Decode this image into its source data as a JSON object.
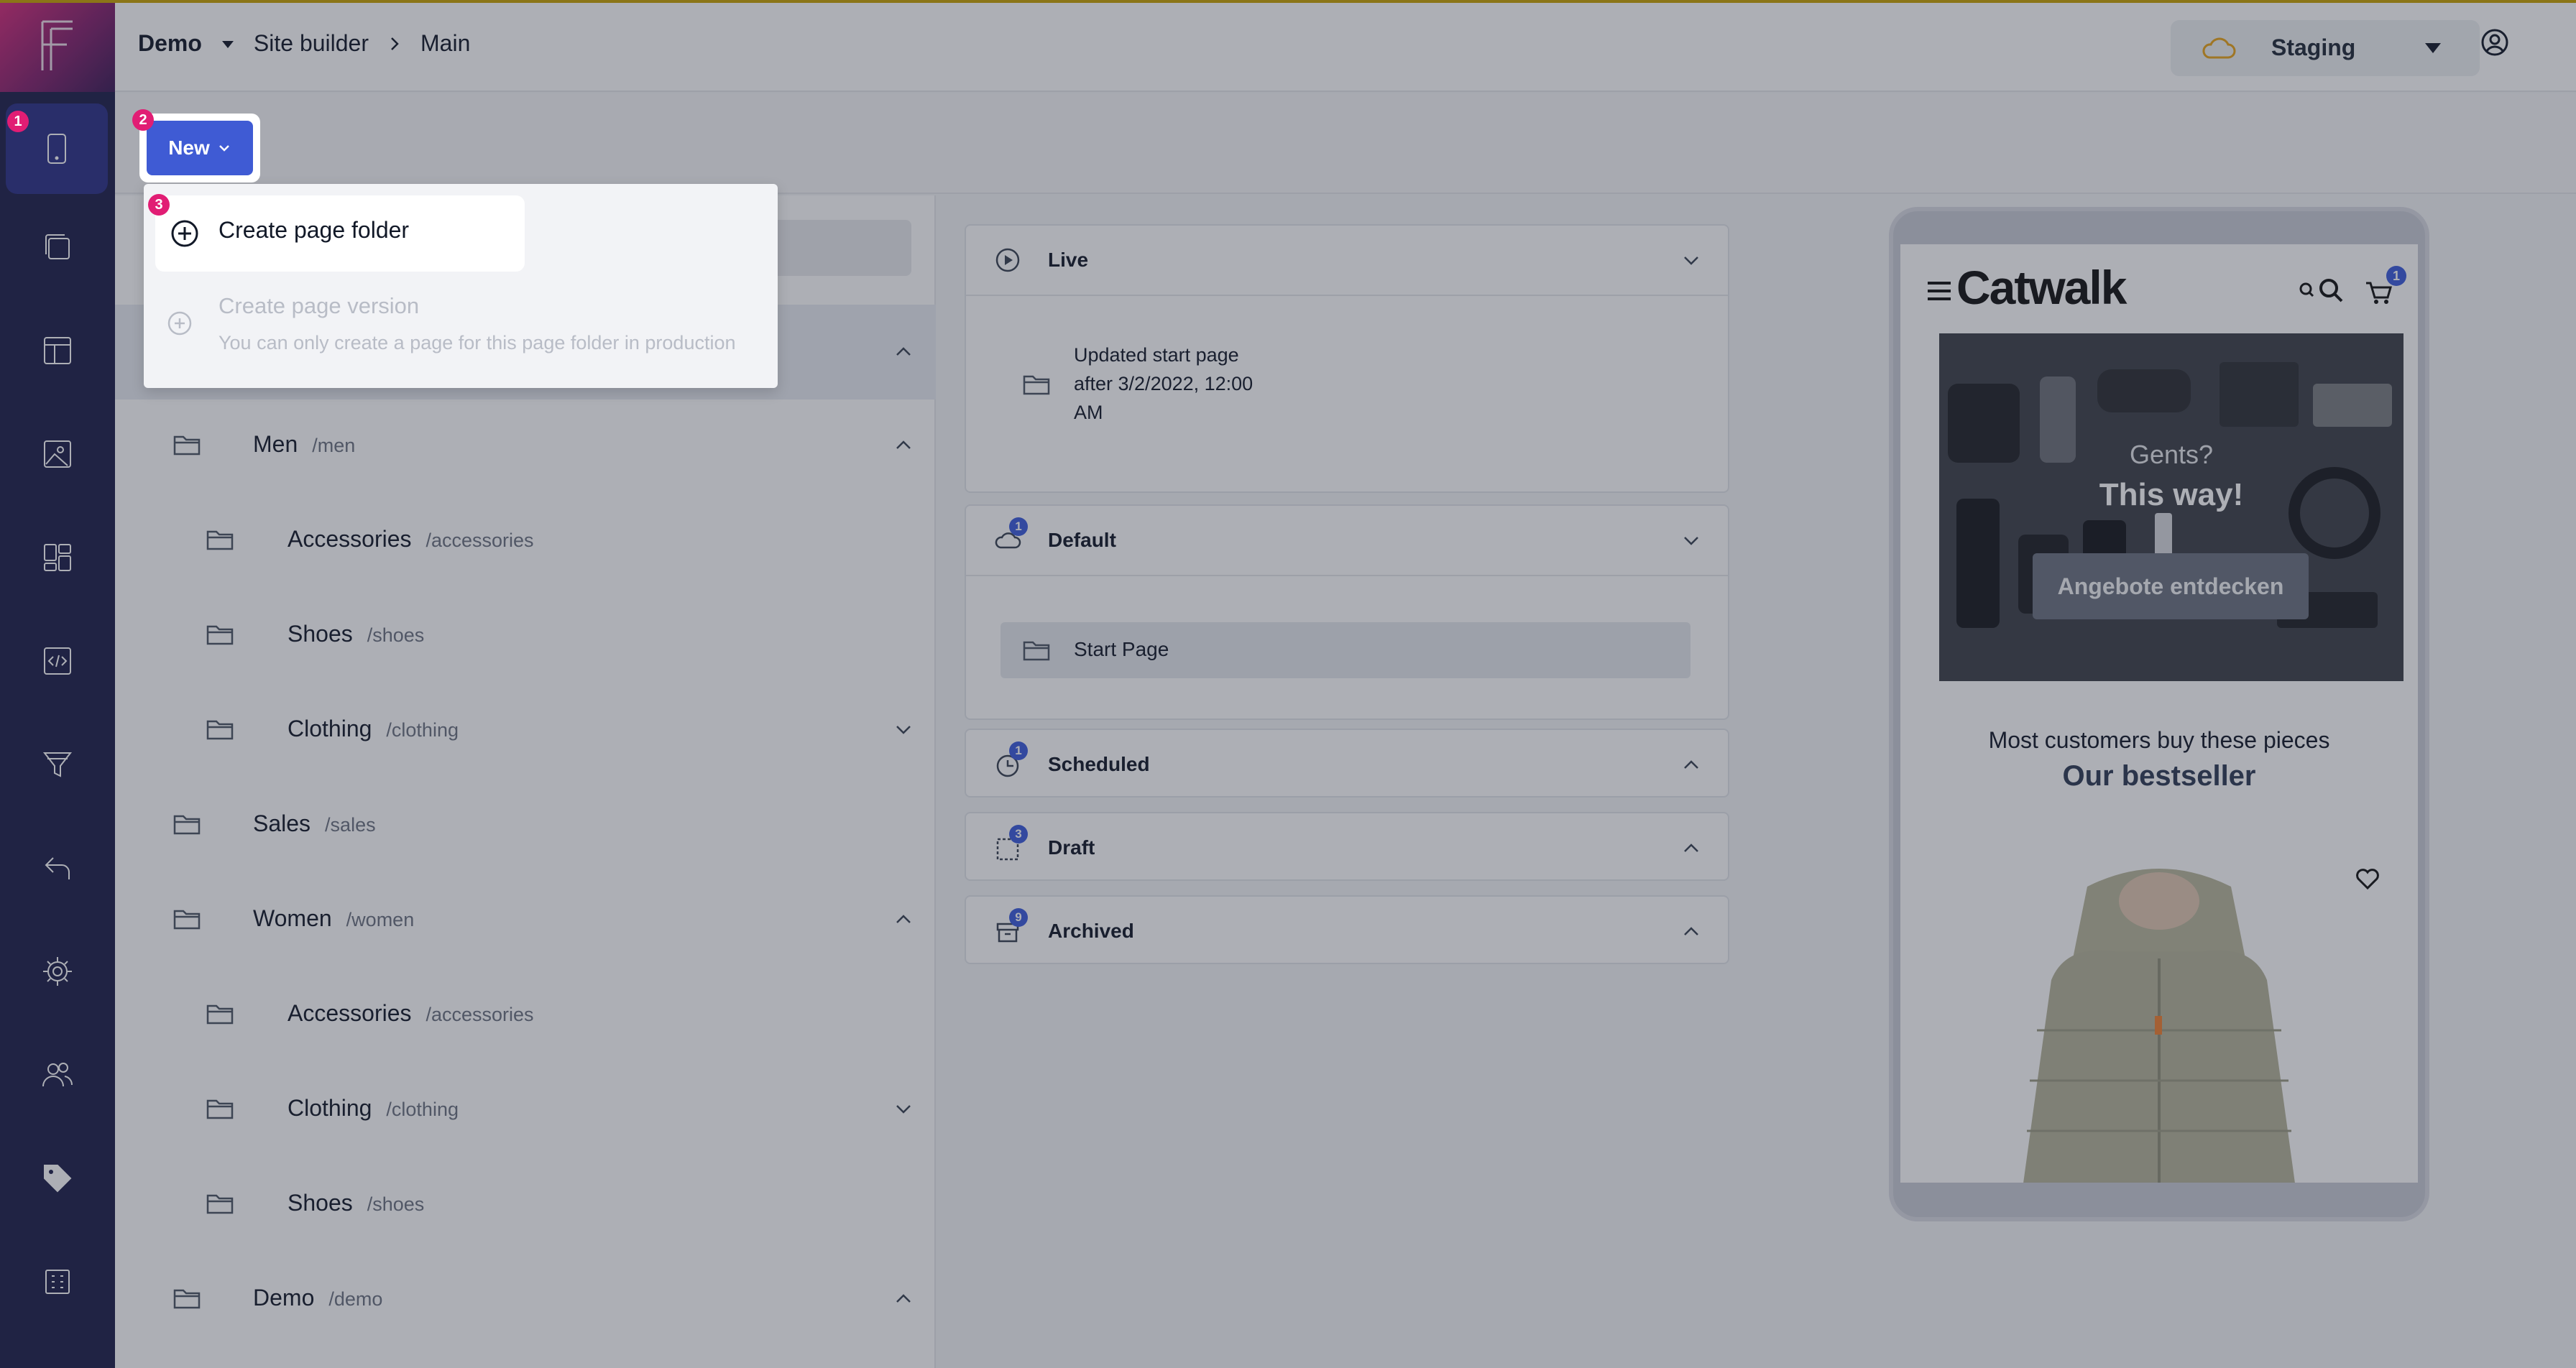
{
  "breadcrumb": {
    "project": "Demo",
    "section": "Site builder",
    "page": "Main"
  },
  "environment": {
    "label": "Staging"
  },
  "toolbar": {
    "new_label": "New"
  },
  "dropdown": {
    "create_folder": "Create page folder",
    "create_version": "Create page version",
    "create_version_hint": "You can only create a page for this page folder in production"
  },
  "steps": {
    "one": "1",
    "two": "2",
    "three": "3"
  },
  "tree": [
    {
      "name": "Men",
      "path": "/men"
    },
    {
      "name": "Accessories",
      "path": "/accessories"
    },
    {
      "name": "Shoes",
      "path": "/shoes"
    },
    {
      "name": "Clothing",
      "path": "/clothing"
    },
    {
      "name": "Sales",
      "path": "/sales"
    },
    {
      "name": "Women",
      "path": "/women"
    },
    {
      "name": "Accessories",
      "path": "/accessories"
    },
    {
      "name": "Clothing",
      "path": "/clothing"
    },
    {
      "name": "Shoes",
      "path": "/shoes"
    },
    {
      "name": "Demo",
      "path": "/demo"
    }
  ],
  "versions": {
    "live": {
      "title": "Live",
      "entry_line1": "Updated start page",
      "entry_line2": "after 3/2/2022, 12:00",
      "entry_line3": "AM"
    },
    "default": {
      "title": "Default",
      "count": "1",
      "entry": "Start Page"
    },
    "scheduled": {
      "title": "Scheduled",
      "count": "1"
    },
    "draft": {
      "title": "Draft",
      "count": "3"
    },
    "archived": {
      "title": "Archived",
      "count": "9"
    }
  },
  "preview": {
    "brand": "Catwalk",
    "cart_count": "1",
    "hero_line1": "Gents?",
    "hero_line2": "This way!",
    "hero_button": "Angebote entdecken",
    "section_line1": "Most customers buy these pieces",
    "section_line2": "Our bestseller"
  },
  "colors": {
    "sidebar": "#1c1d4a",
    "accent": "#3f5bd4",
    "badge": "#e11d74"
  }
}
